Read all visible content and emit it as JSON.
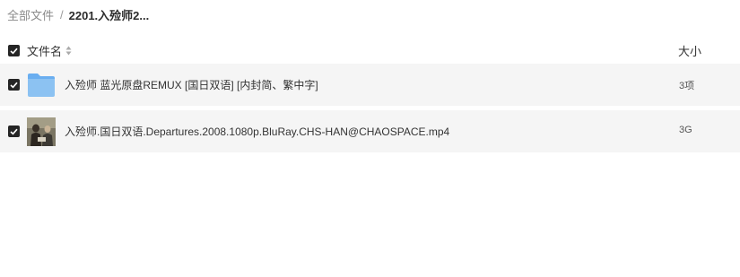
{
  "breadcrumb": {
    "root": "全部文件",
    "separator": "/",
    "current": "2201.入殓师2..."
  },
  "header": {
    "name_column": "文件名",
    "size_column": "大小",
    "select_all_checked": true
  },
  "files": [
    {
      "name": "入殓师 蓝光原盘REMUX [国日双语] [内封简、繁中字]",
      "size": "3项",
      "type": "folder",
      "icon": "folder-icon",
      "checked": true
    },
    {
      "name": "入殓师.国日双语.Departures.2008.1080p.BluRay.CHS-HAN@CHAOSPACE.mp4",
      "size": "3G",
      "type": "video",
      "icon": "video-thumbnail",
      "checked": true
    }
  ],
  "colors": {
    "row_background": "#f5f5f5",
    "checkbox": "#252525",
    "folder_blue": "#8cc2f2"
  }
}
